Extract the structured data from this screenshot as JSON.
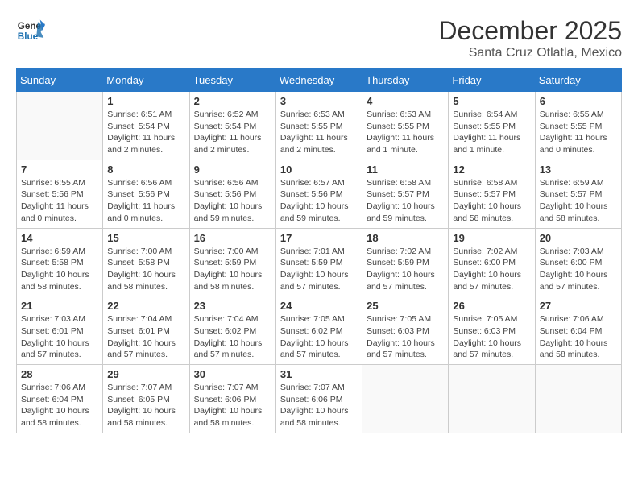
{
  "header": {
    "logo_line1": "General",
    "logo_line2": "Blue",
    "month": "December 2025",
    "location": "Santa Cruz Otlatla, Mexico"
  },
  "weekdays": [
    "Sunday",
    "Monday",
    "Tuesday",
    "Wednesday",
    "Thursday",
    "Friday",
    "Saturday"
  ],
  "weeks": [
    [
      {
        "day": "",
        "info": ""
      },
      {
        "day": "1",
        "info": "Sunrise: 6:51 AM\nSunset: 5:54 PM\nDaylight: 11 hours\nand 2 minutes."
      },
      {
        "day": "2",
        "info": "Sunrise: 6:52 AM\nSunset: 5:54 PM\nDaylight: 11 hours\nand 2 minutes."
      },
      {
        "day": "3",
        "info": "Sunrise: 6:53 AM\nSunset: 5:55 PM\nDaylight: 11 hours\nand 2 minutes."
      },
      {
        "day": "4",
        "info": "Sunrise: 6:53 AM\nSunset: 5:55 PM\nDaylight: 11 hours\nand 1 minute."
      },
      {
        "day": "5",
        "info": "Sunrise: 6:54 AM\nSunset: 5:55 PM\nDaylight: 11 hours\nand 1 minute."
      },
      {
        "day": "6",
        "info": "Sunrise: 6:55 AM\nSunset: 5:55 PM\nDaylight: 11 hours\nand 0 minutes."
      }
    ],
    [
      {
        "day": "7",
        "info": "Sunrise: 6:55 AM\nSunset: 5:56 PM\nDaylight: 11 hours\nand 0 minutes."
      },
      {
        "day": "8",
        "info": "Sunrise: 6:56 AM\nSunset: 5:56 PM\nDaylight: 11 hours\nand 0 minutes."
      },
      {
        "day": "9",
        "info": "Sunrise: 6:56 AM\nSunset: 5:56 PM\nDaylight: 10 hours\nand 59 minutes."
      },
      {
        "day": "10",
        "info": "Sunrise: 6:57 AM\nSunset: 5:56 PM\nDaylight: 10 hours\nand 59 minutes."
      },
      {
        "day": "11",
        "info": "Sunrise: 6:58 AM\nSunset: 5:57 PM\nDaylight: 10 hours\nand 59 minutes."
      },
      {
        "day": "12",
        "info": "Sunrise: 6:58 AM\nSunset: 5:57 PM\nDaylight: 10 hours\nand 58 minutes."
      },
      {
        "day": "13",
        "info": "Sunrise: 6:59 AM\nSunset: 5:57 PM\nDaylight: 10 hours\nand 58 minutes."
      }
    ],
    [
      {
        "day": "14",
        "info": "Sunrise: 6:59 AM\nSunset: 5:58 PM\nDaylight: 10 hours\nand 58 minutes."
      },
      {
        "day": "15",
        "info": "Sunrise: 7:00 AM\nSunset: 5:58 PM\nDaylight: 10 hours\nand 58 minutes."
      },
      {
        "day": "16",
        "info": "Sunrise: 7:00 AM\nSunset: 5:59 PM\nDaylight: 10 hours\nand 58 minutes."
      },
      {
        "day": "17",
        "info": "Sunrise: 7:01 AM\nSunset: 5:59 PM\nDaylight: 10 hours\nand 57 minutes."
      },
      {
        "day": "18",
        "info": "Sunrise: 7:02 AM\nSunset: 5:59 PM\nDaylight: 10 hours\nand 57 minutes."
      },
      {
        "day": "19",
        "info": "Sunrise: 7:02 AM\nSunset: 6:00 PM\nDaylight: 10 hours\nand 57 minutes."
      },
      {
        "day": "20",
        "info": "Sunrise: 7:03 AM\nSunset: 6:00 PM\nDaylight: 10 hours\nand 57 minutes."
      }
    ],
    [
      {
        "day": "21",
        "info": "Sunrise: 7:03 AM\nSunset: 6:01 PM\nDaylight: 10 hours\nand 57 minutes."
      },
      {
        "day": "22",
        "info": "Sunrise: 7:04 AM\nSunset: 6:01 PM\nDaylight: 10 hours\nand 57 minutes."
      },
      {
        "day": "23",
        "info": "Sunrise: 7:04 AM\nSunset: 6:02 PM\nDaylight: 10 hours\nand 57 minutes."
      },
      {
        "day": "24",
        "info": "Sunrise: 7:05 AM\nSunset: 6:02 PM\nDaylight: 10 hours\nand 57 minutes."
      },
      {
        "day": "25",
        "info": "Sunrise: 7:05 AM\nSunset: 6:03 PM\nDaylight: 10 hours\nand 57 minutes."
      },
      {
        "day": "26",
        "info": "Sunrise: 7:05 AM\nSunset: 6:03 PM\nDaylight: 10 hours\nand 57 minutes."
      },
      {
        "day": "27",
        "info": "Sunrise: 7:06 AM\nSunset: 6:04 PM\nDaylight: 10 hours\nand 58 minutes."
      }
    ],
    [
      {
        "day": "28",
        "info": "Sunrise: 7:06 AM\nSunset: 6:04 PM\nDaylight: 10 hours\nand 58 minutes."
      },
      {
        "day": "29",
        "info": "Sunrise: 7:07 AM\nSunset: 6:05 PM\nDaylight: 10 hours\nand 58 minutes."
      },
      {
        "day": "30",
        "info": "Sunrise: 7:07 AM\nSunset: 6:06 PM\nDaylight: 10 hours\nand 58 minutes."
      },
      {
        "day": "31",
        "info": "Sunrise: 7:07 AM\nSunset: 6:06 PM\nDaylight: 10 hours\nand 58 minutes."
      },
      {
        "day": "",
        "info": ""
      },
      {
        "day": "",
        "info": ""
      },
      {
        "day": "",
        "info": ""
      }
    ]
  ]
}
